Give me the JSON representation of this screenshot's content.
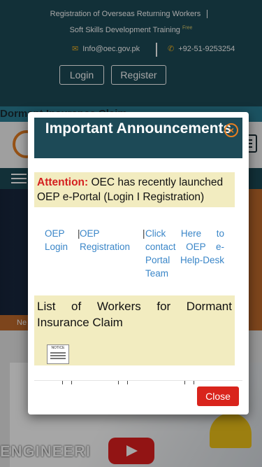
{
  "topbar": {
    "link1": "Registration of Overseas Returning Workers",
    "link2": "Soft Skills Development Training",
    "link2_badge": "Free",
    "email": "Info@oec.gov.pk",
    "phone": "+92-51-9253254",
    "login_label": "Login",
    "register_label": "Register"
  },
  "ticker": {
    "text": "Dormant Insurance Claim"
  },
  "hero": {
    "strip_text": "Ne"
  },
  "promo": {
    "text": "ENGINEERI"
  },
  "modal": {
    "title": "Important Announcements",
    "attention_label": "Attention:",
    "attention_text": "OEC has recently launched OEP e-Portal (Login I Registration)",
    "link_login": "OEP Login",
    "link_registration": "OEP Registration",
    "link_helpdesk": "Click Here to contact OEP e-Portal Help-Desk Team",
    "separator": "|",
    "list_title": "List of Workers for Dormant Insurance Claim",
    "notice_image_text": "NOTICE",
    "close_label": "Close",
    "close_icon": "×"
  },
  "icons": {
    "email": "envelope-icon",
    "phone": "phone-icon",
    "menu": "hamburger-icon",
    "play": "play-icon"
  },
  "colors": {
    "header_bg": "#1d4a57",
    "accent_orange": "#e67e22",
    "notice_bg": "#f2ecc0",
    "link_blue": "#3a86c8",
    "attention_red": "#d42020",
    "close_red": "#d9241c"
  }
}
